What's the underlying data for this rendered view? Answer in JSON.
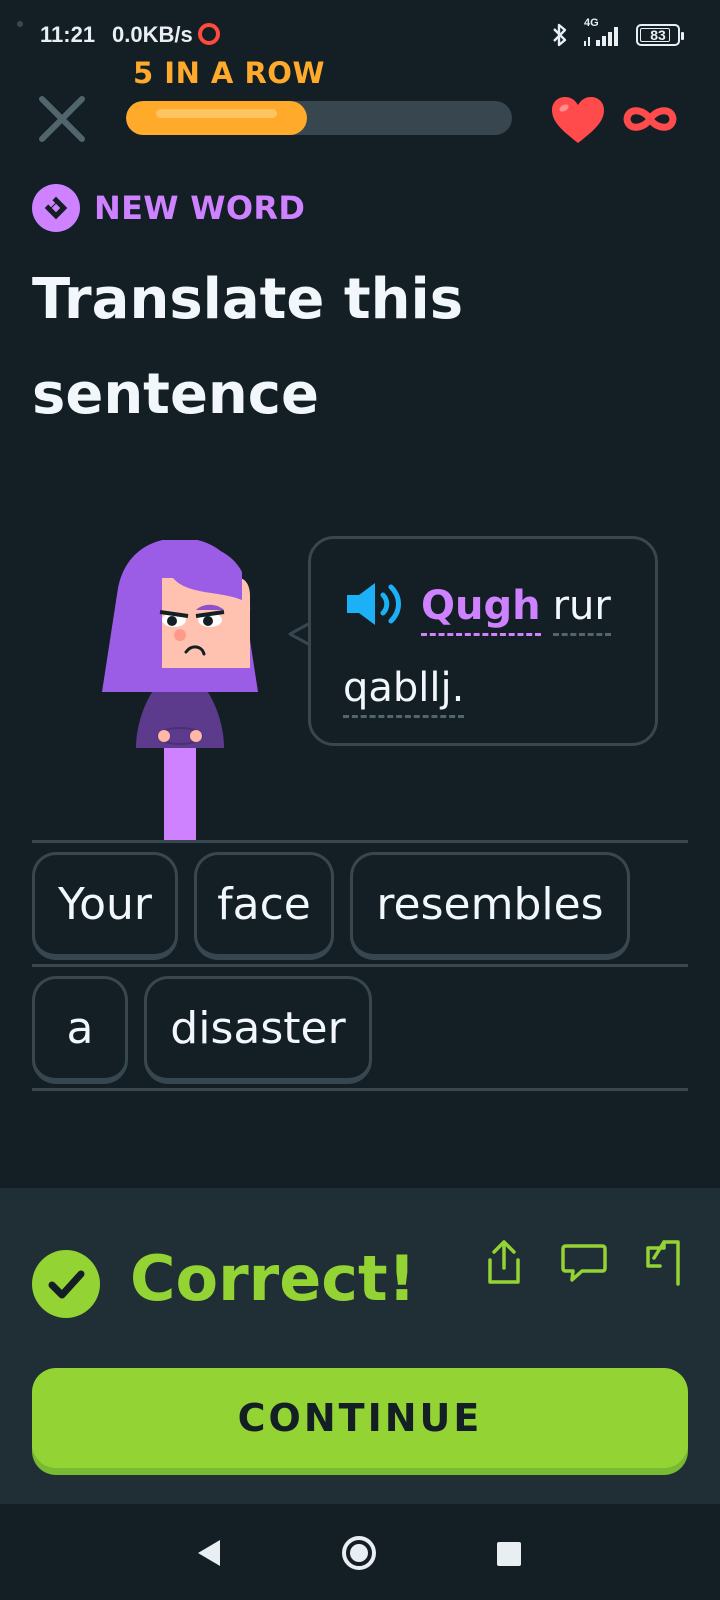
{
  "status_bar": {
    "time": "11:21",
    "network_speed": "0.0KB/s",
    "signal_type": "4G",
    "battery": "83"
  },
  "header": {
    "streak_label": "5 IN A ROW",
    "progress_fraction": 0.47,
    "hearts": "∞"
  },
  "lesson": {
    "badge_label": "NEW WORD",
    "title": "Translate this sentence",
    "sentence_words": [
      {
        "text": "Qugh",
        "is_new": true
      },
      {
        "text": "rur",
        "is_new": false
      },
      {
        "text": "qabllj.",
        "is_new": false
      }
    ]
  },
  "answer": {
    "tiles": [
      "Your",
      "face",
      "resembles",
      "a",
      "disaster"
    ]
  },
  "feedback": {
    "status": "Correct!",
    "continue_label": "CONTINUE"
  },
  "colors": {
    "background": "#131f24",
    "accent_purple": "#ce82ff",
    "streak_orange": "#ffaa2b",
    "correct_green": "#93d333",
    "heart_red": "#ff4b4b",
    "speaker_blue": "#1cb0f6"
  },
  "icons": {
    "close": "close-icon",
    "heart": "heart-icon",
    "infinity": "infinity-icon",
    "speaker": "speaker-icon",
    "check": "check-icon",
    "share": "share-icon",
    "comment": "comment-icon",
    "flag": "flag-icon"
  }
}
